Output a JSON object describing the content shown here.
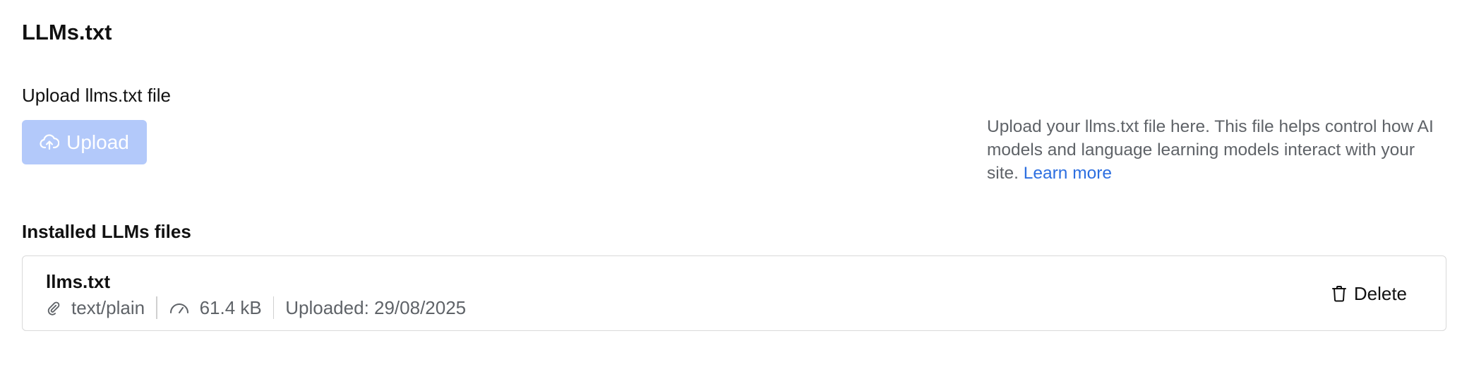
{
  "page": {
    "title": "LLMs.txt"
  },
  "upload": {
    "label": "Upload llms.txt file",
    "button_label": "Upload",
    "button_icon": "cloud-upload-icon",
    "button_color": "#b3c9fa",
    "help_text": "Upload your llms.txt file here. This file helps control how AI models and language learning models interact with your site.",
    "learn_more_label": "Learn more",
    "link_color": "#2d6fe0"
  },
  "installed": {
    "title": "Installed LLMs files",
    "files": [
      {
        "name": "llms.txt",
        "type": "text/plain",
        "type_icon": "paperclip-icon",
        "size": "61.4 kB",
        "size_icon": "gauge-icon",
        "uploaded": "Uploaded: 29/08/2025",
        "delete_label": "Delete",
        "delete_icon": "trash-icon"
      }
    ]
  }
}
